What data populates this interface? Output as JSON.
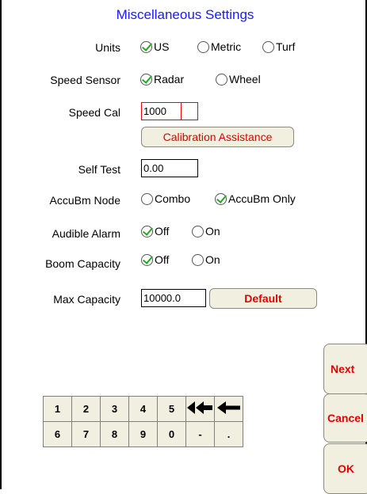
{
  "title": "Miscellaneous Settings",
  "units": {
    "label": "Units",
    "options": [
      "US",
      "Metric",
      "Turf"
    ],
    "selected": "US"
  },
  "speed_sensor": {
    "label": "Speed Sensor",
    "options": [
      "Radar",
      "Wheel"
    ],
    "selected": "Radar"
  },
  "speed_cal": {
    "label": "Speed Cal",
    "value": "1000"
  },
  "calibration_assistance": "Calibration Assistance",
  "self_test": {
    "label": "Self Test",
    "value": "0.00"
  },
  "accubm_node": {
    "label": "AccuBm Node",
    "options": [
      "Combo",
      "AccuBm Only"
    ],
    "selected": "AccuBm Only"
  },
  "audible_alarm": {
    "label": "Audible Alarm",
    "options": [
      "Off",
      "On"
    ],
    "selected": "Off"
  },
  "boom_capacity": {
    "label": "Boom Capacity",
    "options": [
      "Off",
      "On"
    ],
    "selected": "Off"
  },
  "max_capacity": {
    "label": "Max Capacity",
    "value": "10000.0",
    "default_label": "Default"
  },
  "nav": {
    "next": "Next",
    "cancel": "Cancel",
    "ok": "OK"
  },
  "keypad": {
    "row1": [
      "1",
      "2",
      "3",
      "4",
      "5",
      "◀◀",
      "◀"
    ],
    "row2": [
      "6",
      "7",
      "8",
      "9",
      "0",
      "-",
      "."
    ]
  },
  "colors": {
    "accent_red": "#e00000",
    "title_blue": "#1a1aff",
    "check_green": "#22aa22"
  }
}
